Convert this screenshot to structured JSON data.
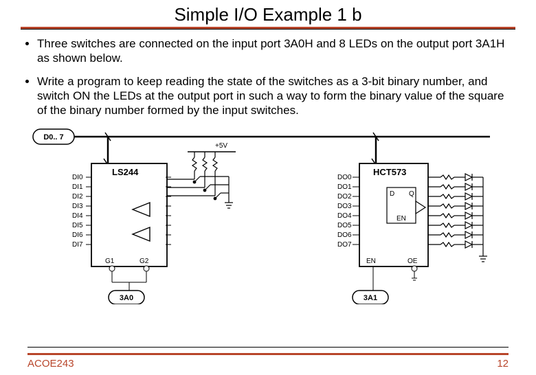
{
  "title": "Simple I/O Example 1 b",
  "bullets": [
    "Three switches are connected on the input port 3A0H and 8 LEDs on the output port 3A1H as shown below.",
    "Write a program to keep reading the state of the switches as a 3-bit binary number, and switch ON the LEDs at the output port in such a way to form the binary value of the square of the binary number formed by the input switches."
  ],
  "diagram": {
    "bus_label": "D0.. 7",
    "voltage": "+5V",
    "input_chip": "LS244",
    "output_chip": "HCT573",
    "input_port": "3A0",
    "output_port": "3A1",
    "di_pins": [
      "DI0",
      "DI1",
      "DI2",
      "DI3",
      "DI4",
      "DI5",
      "DI6",
      "DI7"
    ],
    "do_pins": [
      "DO0",
      "DO1",
      "DO2",
      "DO3",
      "DO4",
      "DO5",
      "DO6",
      "DO7"
    ],
    "g_pins": [
      "G1",
      "G2"
    ],
    "latch_pins": [
      "D",
      "Q",
      "EN",
      "OE"
    ]
  },
  "footer": {
    "left": "ACOE243",
    "right": "12"
  }
}
